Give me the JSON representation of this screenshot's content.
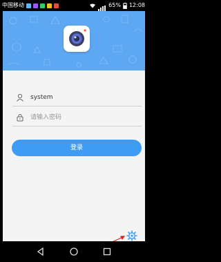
{
  "status_bar": {
    "carrier": "中国移动",
    "battery_percent": "65%",
    "time": "12:08"
  },
  "login": {
    "username_value": "system",
    "password_placeholder": "请输入密码",
    "login_button_label": "登录"
  },
  "icons": {
    "app_logo": "camera-lens-icon",
    "username": "user-icon",
    "password": "lock-icon",
    "settings": "gear-icon",
    "annotation": "red-arrow-icon",
    "nav_back": "back-triangle-icon",
    "nav_home": "home-circle-icon",
    "nav_recents": "recents-square-icon"
  },
  "colors": {
    "header_blue": "#5ea8f3",
    "button_blue": "#3f9cf5",
    "background": "#f4f4f4",
    "annotation_red": "#e02020"
  }
}
